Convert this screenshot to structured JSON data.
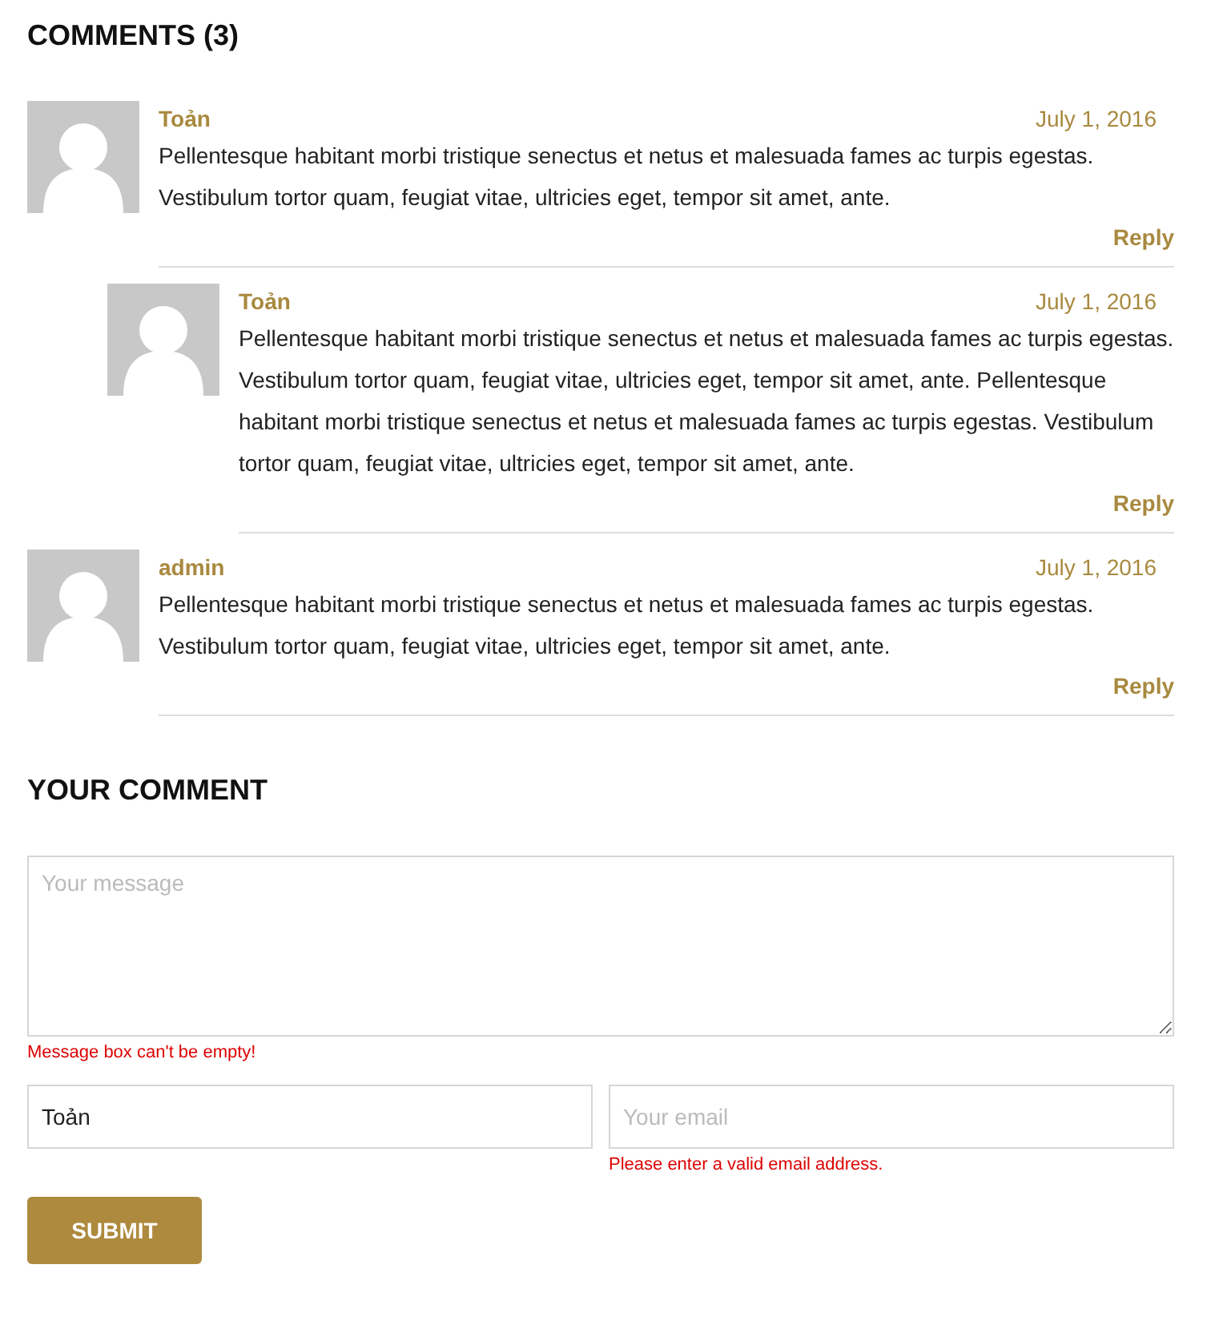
{
  "comments_heading": "COMMENTS (3)",
  "comments": [
    {
      "author": "Toản",
      "date": "July 1, 2016",
      "text": "Pellentesque habitant morbi tristique senectus et netus et malesuada fames ac turpis egestas. Vestibulum tortor quam, feugiat vitae, ultricies eget, tempor sit amet, ante.",
      "reply": "Reply",
      "children": [
        {
          "author": "Toản",
          "date": "July 1, 2016",
          "text": "Pellentesque habitant morbi tristique senectus et netus et malesuada fames ac turpis egestas. Vestibulum tortor quam, feugiat vitae, ultricies eget, tempor sit amet, ante. Pellentesque habitant morbi tristique senectus et netus et malesuada fames ac turpis egestas. Vestibulum tortor quam, feugiat vitae, ultricies eget, tempor sit amet, ante.",
          "reply": "Reply"
        }
      ]
    },
    {
      "author": "admin",
      "date": "July 1, 2016",
      "text": "Pellentesque habitant morbi tristique senectus et netus et malesuada fames ac turpis egestas. Vestibulum tortor quam, feugiat vitae, ultricies eget, tempor sit amet, ante.",
      "reply": "Reply"
    }
  ],
  "form": {
    "heading": "YOUR COMMENT",
    "message": {
      "placeholder": "Your message",
      "error": "Message box can't be empty!"
    },
    "name": {
      "value": "Toản"
    },
    "email": {
      "placeholder": "Your email",
      "error": "Please enter a valid email address."
    },
    "submit": "SUBMIT"
  }
}
